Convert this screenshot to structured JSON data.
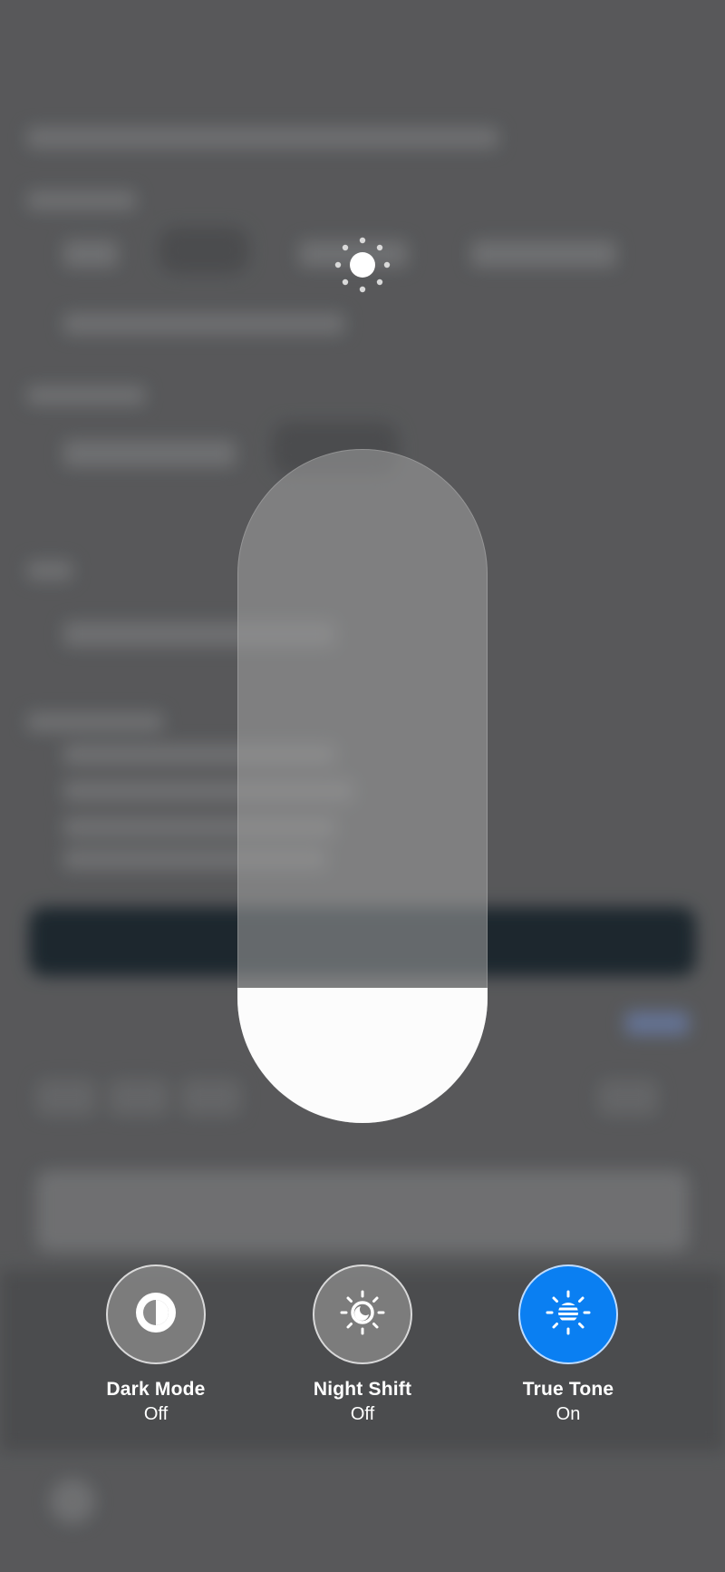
{
  "brightness": {
    "icon": "sun-icon",
    "level": 0.2
  },
  "toggles": [
    {
      "id": "dark-mode",
      "icon": "dark-mode-icon",
      "label": "Dark Mode",
      "state": "Off",
      "active": false
    },
    {
      "id": "night-shift",
      "icon": "night-shift-icon",
      "label": "Night Shift",
      "state": "Off",
      "active": false
    },
    {
      "id": "true-tone",
      "icon": "true-tone-icon",
      "label": "True Tone",
      "state": "On",
      "active": true
    }
  ],
  "colors": {
    "active_toggle": "#0a7ff2",
    "slider_fill": "#fcfcfc"
  }
}
